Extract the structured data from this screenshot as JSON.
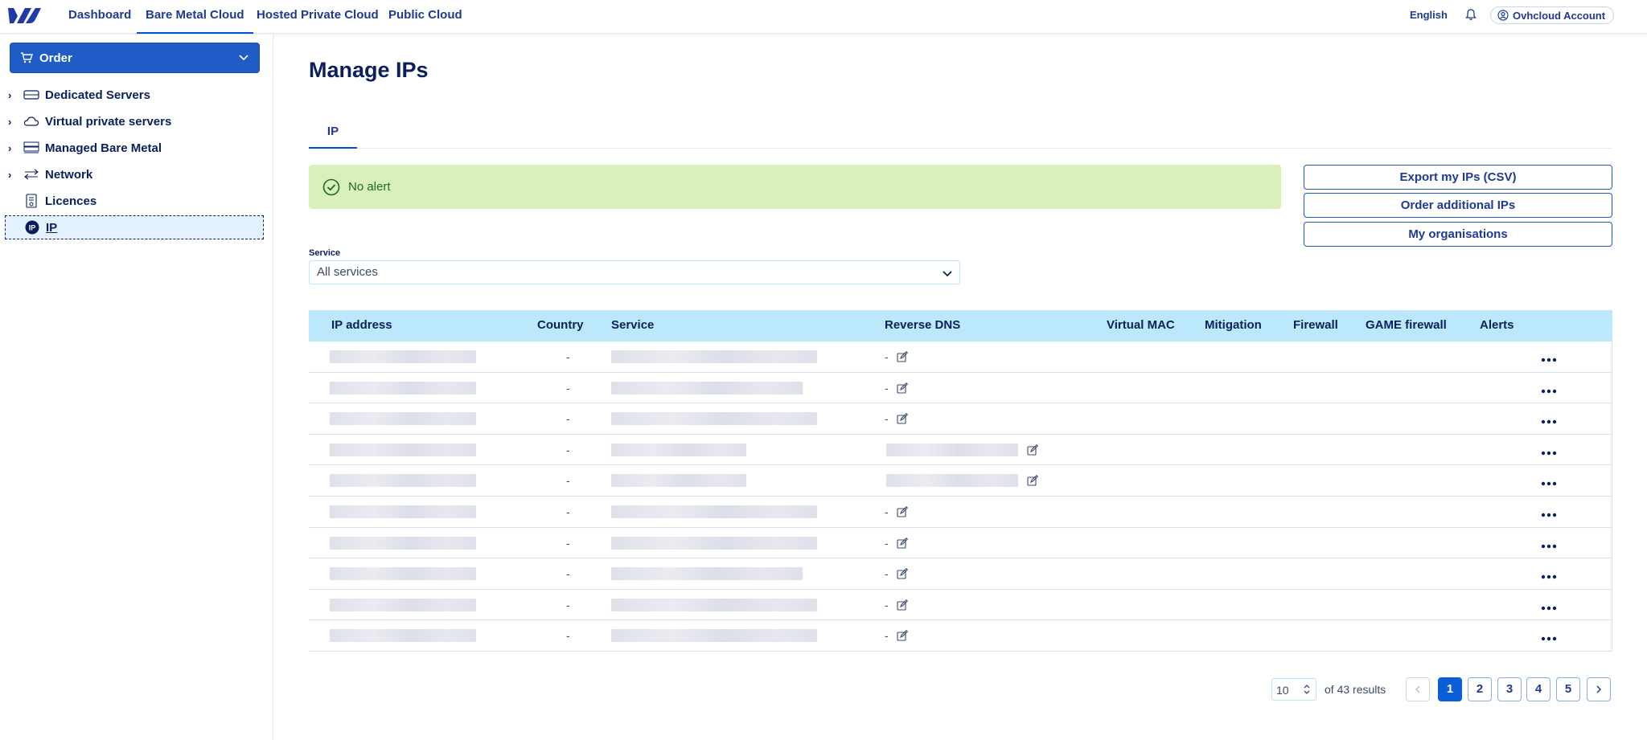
{
  "topnav": {
    "links": [
      "Dashboard",
      "Bare Metal Cloud",
      "Hosted Private Cloud",
      "Public Cloud"
    ],
    "active_index": 1,
    "language": "English",
    "account": "Ovhcloud Account"
  },
  "sidebar": {
    "order_label": "Order",
    "items": [
      {
        "label": "Dedicated Servers",
        "icon": "server-icon",
        "expandable": true
      },
      {
        "label": "Virtual private servers",
        "icon": "cloud-icon",
        "expandable": true
      },
      {
        "label": "Managed Bare Metal",
        "icon": "bare-metal-icon",
        "expandable": true
      },
      {
        "label": "Network",
        "icon": "network-icon",
        "expandable": true
      },
      {
        "label": "Licences",
        "icon": "licence-icon",
        "expandable": false
      },
      {
        "label": "IP",
        "icon": "ip-icon",
        "expandable": false
      }
    ]
  },
  "main": {
    "title": "Manage IPs",
    "tabs": [
      "IP"
    ],
    "alert": "No alert",
    "actions": [
      "Export my IPs (CSV)",
      "Order additional IPs",
      "My organisations"
    ],
    "service_filter": {
      "label": "Service",
      "value": "All services"
    }
  },
  "table": {
    "columns": [
      "IP address",
      "Country",
      "Service",
      "Reverse DNS",
      "Virtual MAC",
      "Mitigation",
      "Firewall",
      "GAME firewall",
      "Alerts"
    ],
    "rows": [
      {
        "country": "-",
        "reverse_dns": "-",
        "dns_hidden": false
      },
      {
        "country": "-",
        "reverse_dns": "-",
        "dns_hidden": false
      },
      {
        "country": "-",
        "reverse_dns": "-",
        "dns_hidden": false
      },
      {
        "country": "-",
        "reverse_dns": "",
        "dns_hidden": true
      },
      {
        "country": "-",
        "reverse_dns": "",
        "dns_hidden": true
      },
      {
        "country": "-",
        "reverse_dns": "-",
        "dns_hidden": false
      },
      {
        "country": "-",
        "reverse_dns": "-",
        "dns_hidden": false
      },
      {
        "country": "-",
        "reverse_dns": "-",
        "dns_hidden": false
      },
      {
        "country": "-",
        "reverse_dns": "-",
        "dns_hidden": false
      },
      {
        "country": "-",
        "reverse_dns": "-",
        "dns_hidden": false
      }
    ]
  },
  "pagination": {
    "page_size": "10",
    "results_text": "of 43 results",
    "pages": [
      "1",
      "2",
      "3",
      "4",
      "5"
    ],
    "current_page": "1",
    "prev_icon": "chevron-left-icon",
    "next_icon": "chevron-right-icon"
  },
  "colors": {
    "brand_primary": "#1f5cc8",
    "header_row": "#bce8fb",
    "alert_bg": "#d9f0bd",
    "text_dark": "#0b1f5c"
  }
}
